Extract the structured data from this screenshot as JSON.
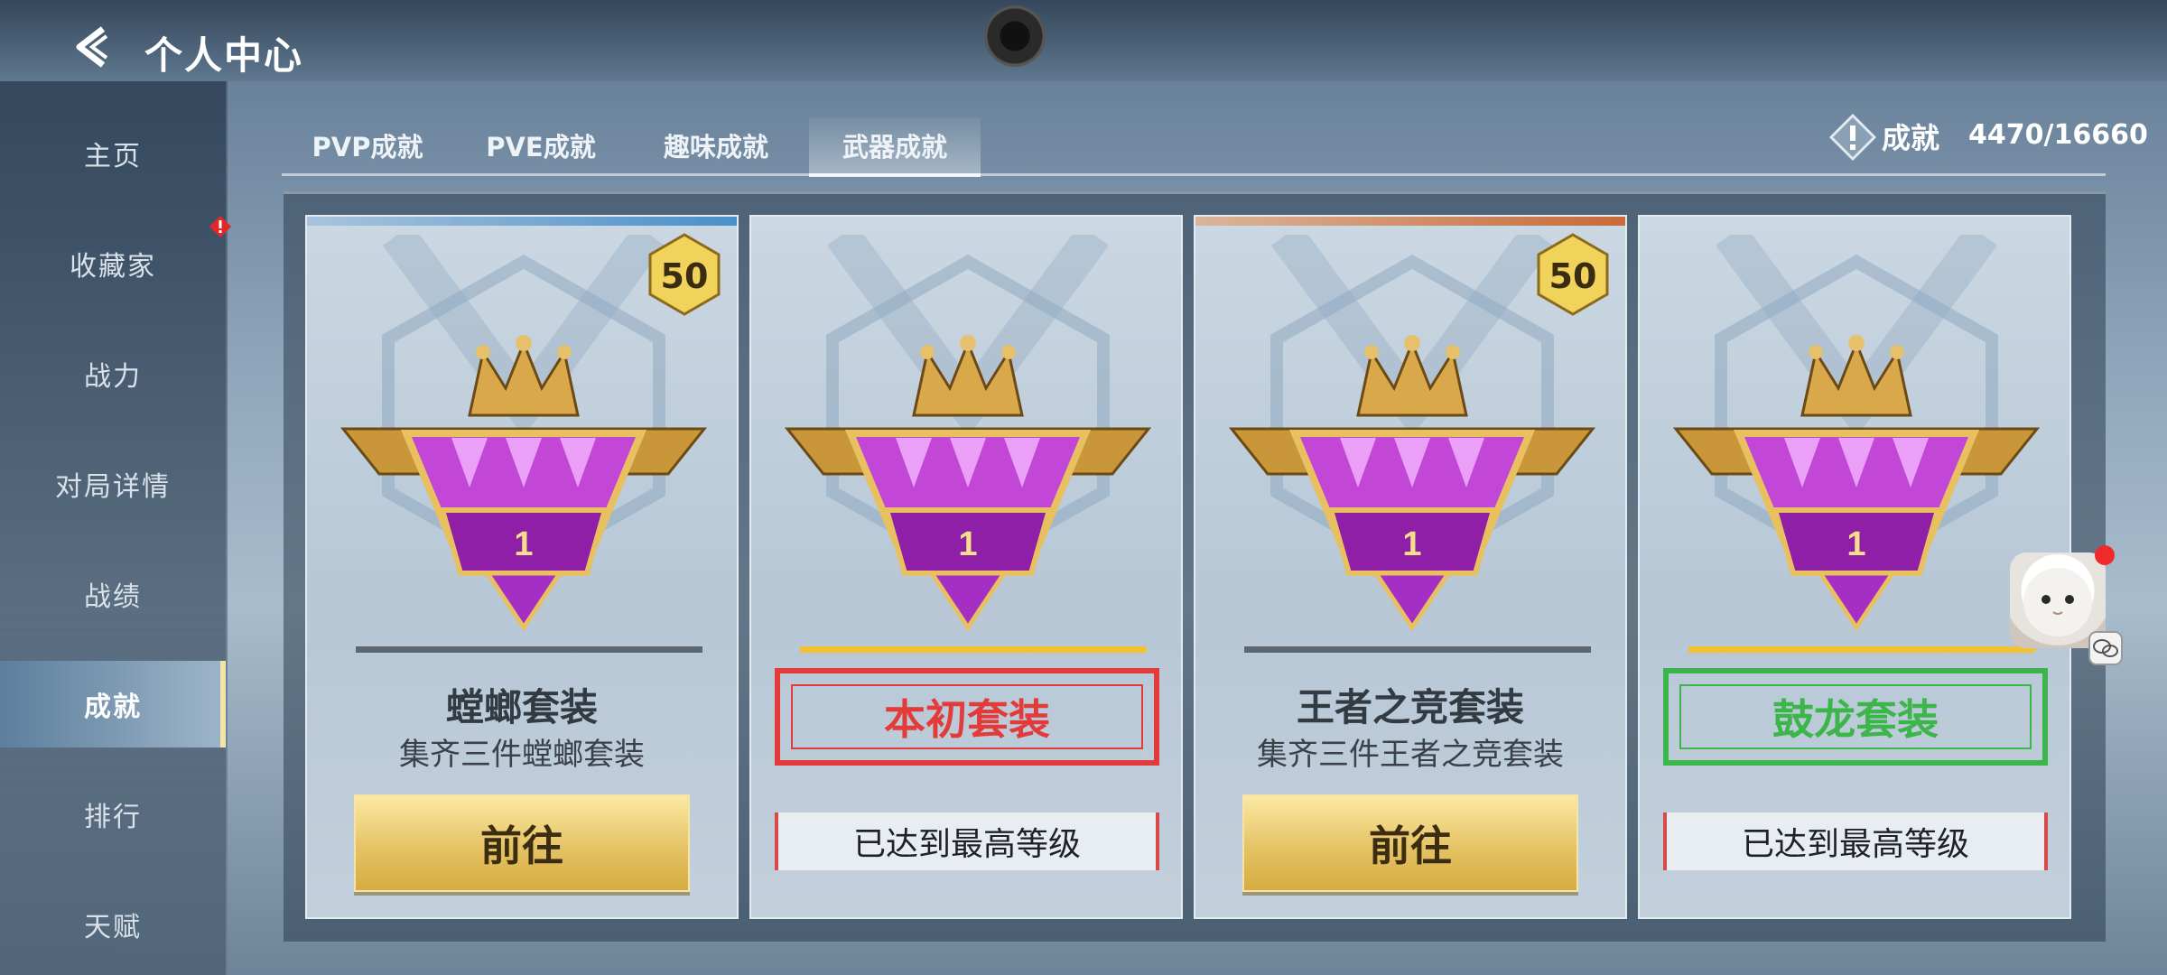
{
  "header": {
    "title": "个人中心",
    "back_icon": "back-arrow-icon"
  },
  "sidebar": {
    "items": [
      {
        "label": "主页"
      },
      {
        "label": "收藏家",
        "has_alert": true
      },
      {
        "label": "战力"
      },
      {
        "label": "对局详情"
      },
      {
        "label": "战绩"
      },
      {
        "label": "成就",
        "active": true
      },
      {
        "label": "排行"
      },
      {
        "label": "天赋"
      }
    ]
  },
  "tabs": [
    {
      "label": "PVP成就"
    },
    {
      "label": "PVE成就"
    },
    {
      "label": "趣味成就"
    },
    {
      "label": "武器成就",
      "active": true
    }
  ],
  "achievement": {
    "label": "成就",
    "count": "4470/16660"
  },
  "cards": [
    {
      "title": "螳螂套装",
      "subtitle": "集齐三件螳螂套装",
      "level": "50",
      "rank_number": "1",
      "button": "前往"
    },
    {
      "title": "本初套装",
      "rank_number": "1",
      "status": "已达到最高等级",
      "highlight": "red"
    },
    {
      "title": "王者之竞套装",
      "subtitle": "集齐三件王者之竞套装",
      "level": "50",
      "rank_number": "1",
      "button": "前往"
    },
    {
      "title": "鼓龙套装",
      "rank_number": "1",
      "status": "已达到最高等级",
      "highlight": "green"
    }
  ],
  "colors": {
    "gold": "#e3c060",
    "accent_blue": "#4a90c8",
    "highlight_red": "#e33a3a",
    "highlight_green": "#3cb54a",
    "progress_yellow": "#f2c230"
  }
}
